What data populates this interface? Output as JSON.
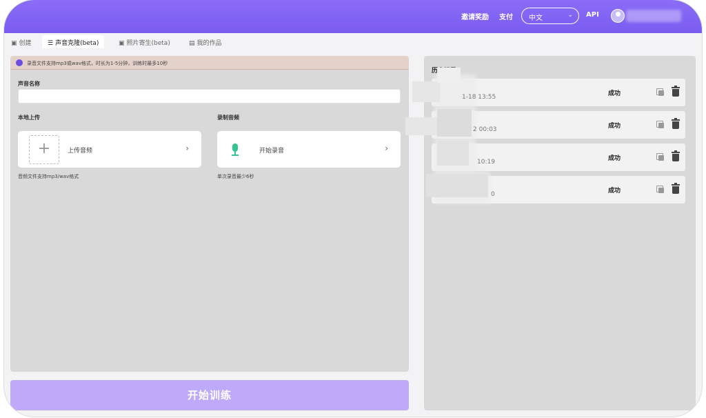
{
  "header": {
    "links": [
      "邀请奖励",
      "支付"
    ],
    "language": "中文",
    "api_label": "API"
  },
  "tabs": [
    {
      "icon": "▣",
      "label": "创建",
      "active": false
    },
    {
      "icon": "☰",
      "label": "声音克隆(beta)",
      "active": true
    },
    {
      "icon": "▣",
      "label": "照片寄生(beta)",
      "active": false
    },
    {
      "icon": "▤",
      "label": "我的作品",
      "active": false
    }
  ],
  "clone_form": {
    "notice": "录音文件支持mp3或wav格式，时长为1-5分钟，训练时最多10秒",
    "name_label": "声音名称",
    "name_value": "",
    "upload_section_label": "本地上传",
    "upload_button": "上传音频",
    "upload_hint": "音频文件支持mp3/wav格式",
    "record_section_label": "录制音频",
    "record_button": "开始录音",
    "record_hint": "单次录音最少6秒",
    "train_button": "开始训练"
  },
  "history": {
    "title": "历史记录",
    "rows": [
      {
        "time": "1-18 13:55",
        "status": "成功"
      },
      {
        "time": "2 00:03",
        "status": "成功"
      },
      {
        "time": "10:19",
        "status": "成功"
      },
      {
        "time": "0",
        "status": "成功"
      }
    ]
  },
  "colors": {
    "brand": "#7b5cf0",
    "train_button": "#bfaaf9",
    "mic": "#34c48f"
  }
}
